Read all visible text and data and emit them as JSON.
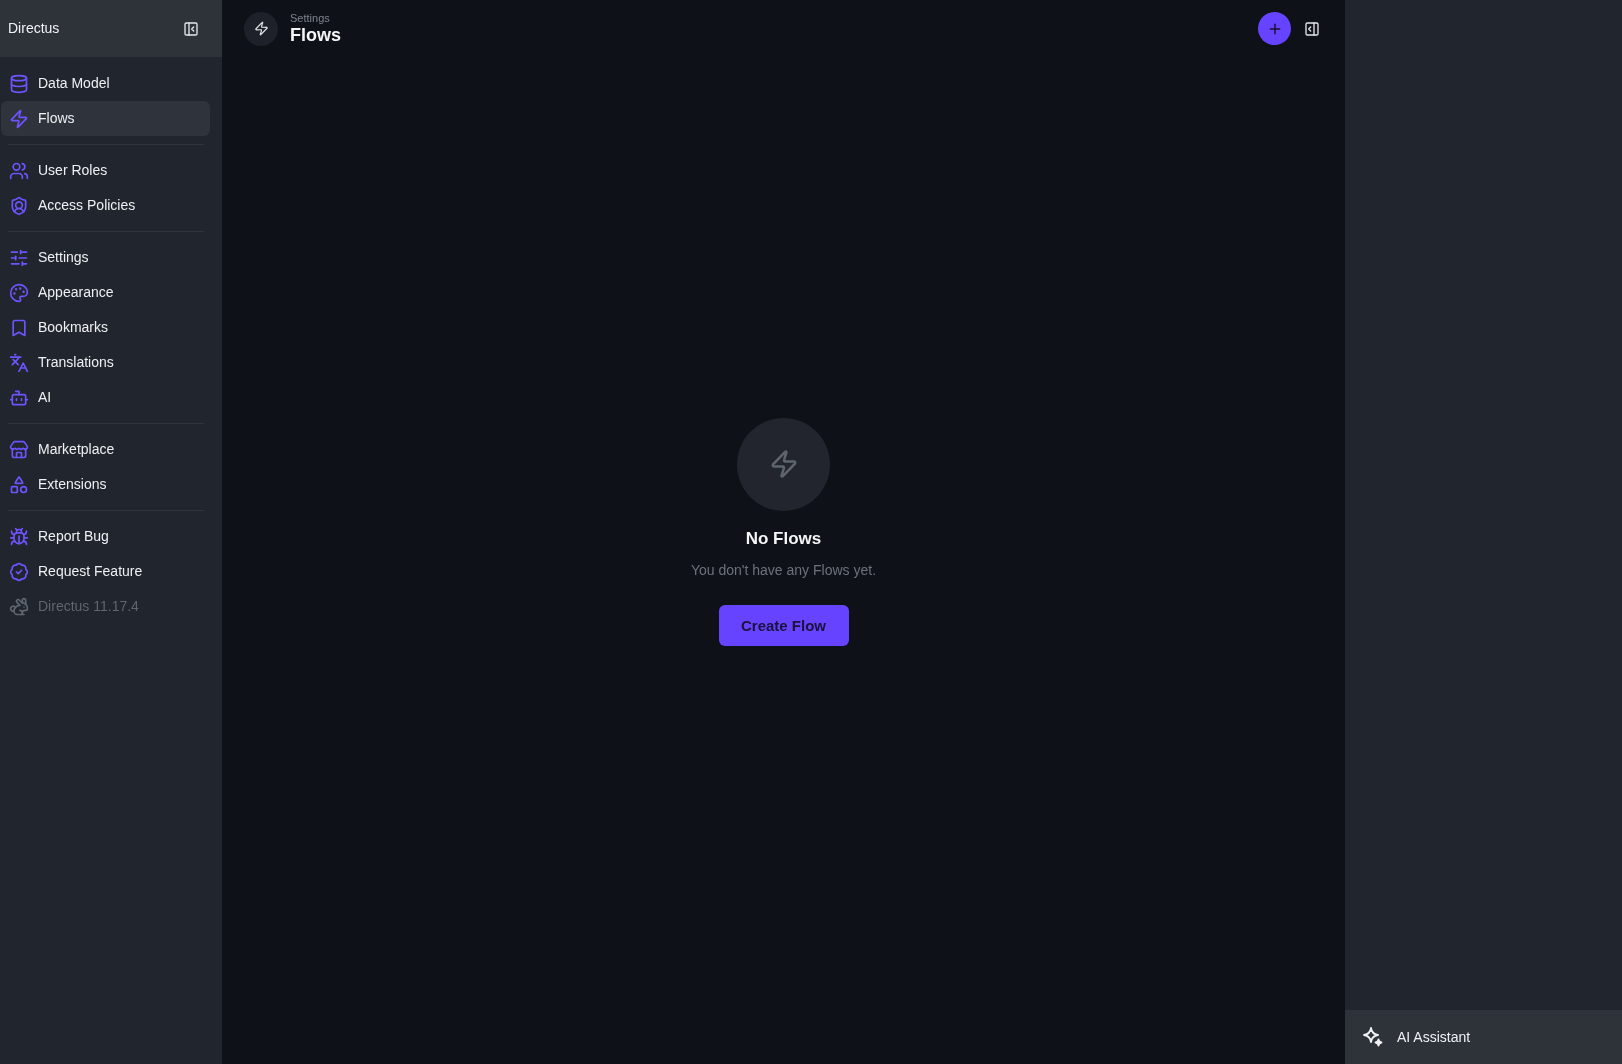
{
  "sidebar": {
    "title": "Directus",
    "groups": [
      {
        "items": [
          {
            "label": "Data Model",
            "selected": false
          },
          {
            "label": "Flows",
            "selected": true
          }
        ]
      },
      {
        "items": [
          {
            "label": "User Roles",
            "selected": false
          },
          {
            "label": "Access Policies",
            "selected": false
          }
        ]
      },
      {
        "items": [
          {
            "label": "Settings",
            "selected": false
          },
          {
            "label": "Appearance",
            "selected": false
          },
          {
            "label": "Bookmarks",
            "selected": false
          },
          {
            "label": "Translations",
            "selected": false
          },
          {
            "label": "AI",
            "selected": false
          }
        ]
      },
      {
        "items": [
          {
            "label": "Marketplace",
            "selected": false
          },
          {
            "label": "Extensions",
            "selected": false
          }
        ]
      },
      {
        "items": [
          {
            "label": "Report Bug",
            "selected": false
          },
          {
            "label": "Request Feature",
            "selected": false
          }
        ]
      }
    ],
    "version": "Directus 11.17.4"
  },
  "header": {
    "breadcrumb": "Settings",
    "title": "Flows"
  },
  "empty_state": {
    "title": "No Flows",
    "message": "You don't have any Flows yet.",
    "button": "Create Flow"
  },
  "assistant_panel": {
    "label": "AI Assistant"
  }
}
